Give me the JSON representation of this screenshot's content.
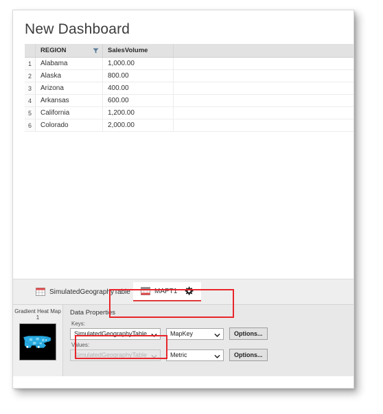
{
  "window": {
    "title": "New Dashboard"
  },
  "grid": {
    "columns": [
      {
        "key": "rownum",
        "label": ""
      },
      {
        "key": "region",
        "label": "REGION"
      },
      {
        "key": "sales",
        "label": "SalesVolume"
      },
      {
        "key": "blank",
        "label": ""
      }
    ],
    "filter_icon": "filter-icon",
    "rows": [
      {
        "num": "1",
        "region": "Alabama",
        "sales": "1,000.00"
      },
      {
        "num": "2",
        "region": "Alaska",
        "sales": "800.00"
      },
      {
        "num": "3",
        "region": "Arizona",
        "sales": "400.00"
      },
      {
        "num": "4",
        "region": "Arkansas",
        "sales": "600.00"
      },
      {
        "num": "5",
        "region": "California",
        "sales": "1,200.00"
      },
      {
        "num": "6",
        "region": "Colorado",
        "sales": "2,000.00"
      }
    ]
  },
  "tabs": {
    "inactive": {
      "label": "SimulatedGeographyTable",
      "icon": "table-icon"
    },
    "active": {
      "label": "MAPT1",
      "icon": "table-icon",
      "settings_icon": "gear-icon"
    }
  },
  "properties": {
    "thumbnail": {
      "label_line1": "Gradient Heat Map",
      "label_line2": "1",
      "image": "us-map-heatmap-thumbnail"
    },
    "section_title": "Data Properties",
    "keys": {
      "label": "Keys:",
      "source_value": "SimulatedGeographyTable",
      "role_value": "MapKey",
      "options_label": "Options..."
    },
    "values": {
      "label": "Values:",
      "source_value": "SimulatedGeographyTable",
      "role_value": "Metric",
      "options_label": "Options..."
    },
    "caret_icon": "chevron-down-icon"
  },
  "colors": {
    "accent_red": "#e8242a",
    "tab_underline": "#e03a3a",
    "map_fill": "#29abe2",
    "header_bg": "#e2e2e2",
    "panel_bg": "#e8e8e8"
  }
}
